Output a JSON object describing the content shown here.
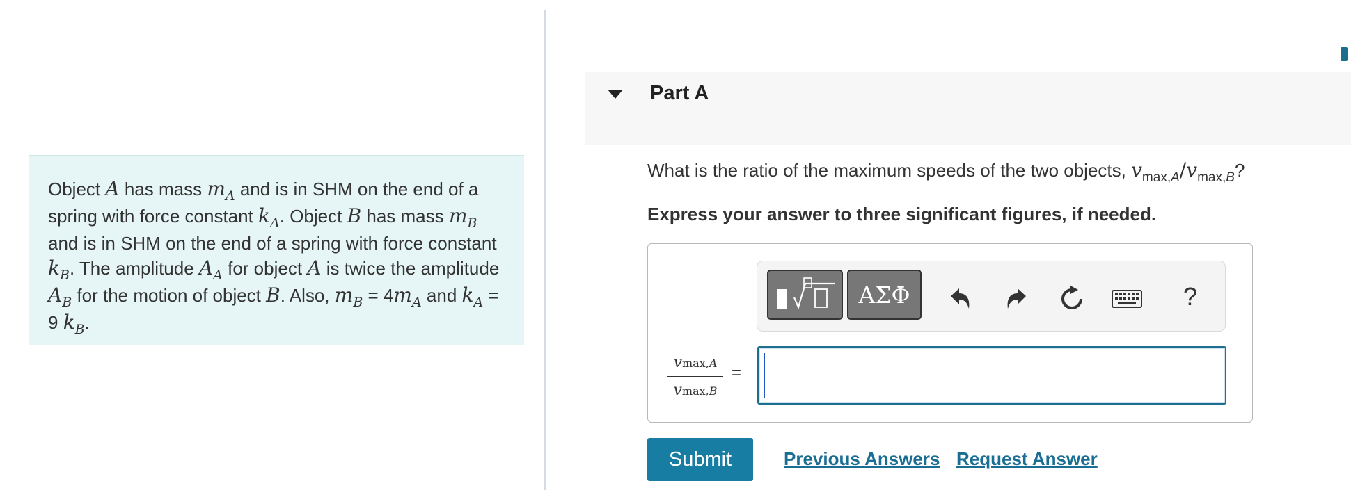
{
  "problem": {
    "segments": [
      {
        "t": "Object "
      },
      {
        "v": "A"
      },
      {
        "t": " has mass "
      },
      {
        "v": "m",
        "s": "A"
      },
      {
        "t": " and is in SHM on the end of a spring with force constant "
      },
      {
        "v": "k",
        "s": "A"
      },
      {
        "t": ". Object "
      },
      {
        "v": "B"
      },
      {
        "t": " has mass "
      },
      {
        "v": "m",
        "s": "B"
      },
      {
        "t": " and is in SHM on the end of a spring with force constant "
      },
      {
        "v": "k",
        "s": "B"
      },
      {
        "t": ". The amplitude "
      },
      {
        "v": "A",
        "s": "A"
      },
      {
        "t": " for object "
      },
      {
        "v": "A"
      },
      {
        "t": " is twice the amplitude "
      },
      {
        "v": "A",
        "s": "B"
      },
      {
        "t": " for the motion of object "
      },
      {
        "v": "B"
      },
      {
        "t": ". Also, "
      },
      {
        "v": "m",
        "s": "B"
      },
      {
        "t": " = 4"
      },
      {
        "v": "m",
        "s": "A"
      },
      {
        "t": " and "
      },
      {
        "v": "k",
        "s": "A"
      },
      {
        "t": " = 9 "
      },
      {
        "v": "k",
        "s": "B"
      },
      {
        "t": "."
      }
    ]
  },
  "part": {
    "title": "Part A"
  },
  "question": {
    "text": "What is the ratio of the maximum speeds of the two objects, ",
    "v1": "v",
    "sub1": "max,",
    "sub1v": "A",
    "slash": "/",
    "v2": "v",
    "sub2": "max,",
    "sub2v": "B",
    "end": "?"
  },
  "instruction": "Express your answer to three significant figures, if needed.",
  "toolbar": {
    "symbols_label": "ΑΣΦ",
    "help_label": "?"
  },
  "equation": {
    "num_var": "v",
    "num_sub": "max,",
    "num_subv": "A",
    "den_var": "v",
    "den_sub": "max,",
    "den_subv": "B",
    "equals": "="
  },
  "answer": {
    "value": ""
  },
  "actions": {
    "submit_label": "Submit",
    "previous_answers_label": "Previous Answers",
    "request_answer_label": "Request Answer"
  },
  "colors": {
    "accent": "#187da3",
    "link": "#1a6d93",
    "problem_bg": "#e6f5f5",
    "part_header_bg": "#f7f7f7"
  }
}
